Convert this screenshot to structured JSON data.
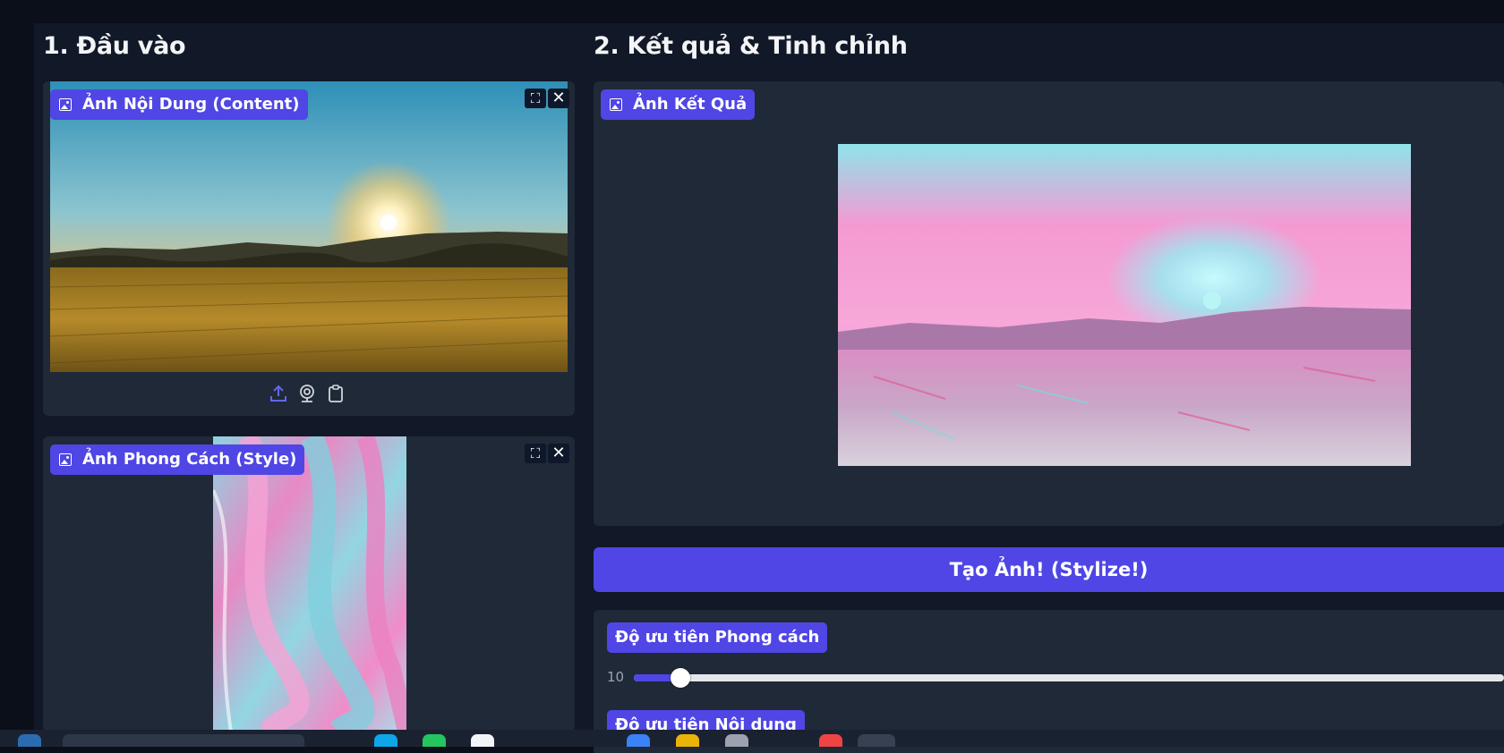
{
  "left": {
    "heading": "1. Đầu vào",
    "content_label": "Ảnh Nội Dung (Content)",
    "style_label": "Ảnh Phong Cách (Style)"
  },
  "right": {
    "heading": "2. Kết quả & Tinh chỉnh",
    "result_label": "Ảnh Kết Quả",
    "stylize_button": "Tạo Ảnh! (Stylize!)"
  },
  "sliders": [
    {
      "label": "Độ ưu tiên Phong cách",
      "value": "10"
    },
    {
      "label": "Độ ưu tiên Nội dung",
      "value": ""
    }
  ],
  "icons": {
    "fullscreen": "fullscreen-icon",
    "close": "close-icon",
    "upload": "upload-icon",
    "webcam": "webcam-icon",
    "clipboard": "clipboard-icon",
    "image": "image-icon"
  },
  "colors": {
    "accent": "#4f46e5",
    "panel": "#1f2937",
    "background": "#111827"
  }
}
